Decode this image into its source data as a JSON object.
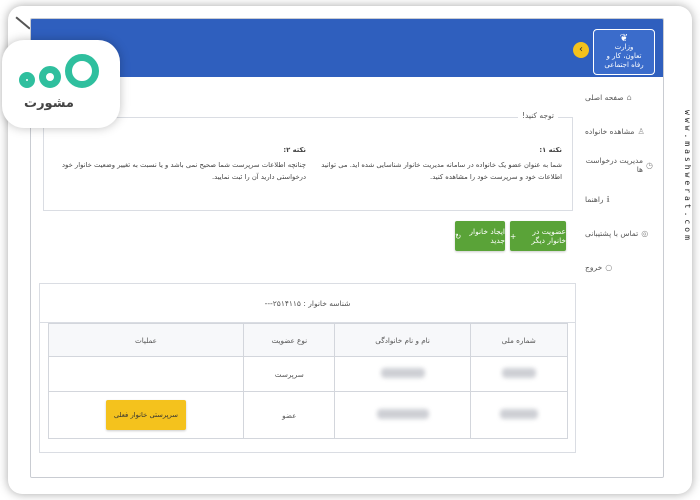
{
  "header": {
    "logo_line1": "وزارت",
    "logo_line2": "تعاون، کار و",
    "logo_line3": "رفاه اجتماعی",
    "collapse_glyph": "‹",
    "bar_color": "#2f5fbe",
    "accent_color": "#f4c21d"
  },
  "sidebar": {
    "items": [
      {
        "label": "صفحه اصلی",
        "icon": "home-icon",
        "glyph": "⌂"
      },
      {
        "label": "مشاهده خانواده",
        "icon": "user-icon",
        "glyph": "♙"
      },
      {
        "label": "مدیریت درخواست ها",
        "icon": "clock-icon",
        "glyph": "◷"
      },
      {
        "label": "راهنما",
        "icon": "info-icon",
        "glyph": "ℹ"
      },
      {
        "label": "تماس با پشتیبانی",
        "icon": "support-icon",
        "glyph": "◎"
      },
      {
        "label": "خروج",
        "icon": "exit-icon",
        "glyph": "○"
      }
    ]
  },
  "notice": {
    "legend": "توجه کنید!",
    "col1_title": "نکته ۱:",
    "col1_text": "شما به عنوان عضو یک خانواده در سامانه مدیریت خانوار شناسایی شده اید. می توانید اطلاعات خود و سرپرست خود را مشاهده کنید.",
    "col2_title": "نکته ۲:",
    "col2_text": "چنانچه اطلاعات سرپرست شما صحیح نمی باشد و یا نسبت به تغییر وضعیت خانوار خود درخواستی دارید آن را ثبت نمایید."
  },
  "actions": {
    "member_label": "عضویت در خانوار دیگر",
    "member_glyph": "+",
    "create_label": "ایجاد خانوار جدید",
    "create_glyph": "↻",
    "green_color": "#5aa338"
  },
  "family": {
    "title": "شناسه خانوار : ۲۵۱۴۱۱۵---",
    "columns": [
      "شماره ملی",
      "نام و نام خانوادگی",
      "نوع عضویت",
      "عملیات"
    ],
    "rows": [
      {
        "role": "سرپرست",
        "action": ""
      },
      {
        "role": "عضو",
        "action": "سرپرستی خانوار فعلی"
      }
    ]
  },
  "watermark": {
    "brand": "مشورت",
    "site": "www.mashwerat.com",
    "brand_color": "#2fbf9e"
  }
}
